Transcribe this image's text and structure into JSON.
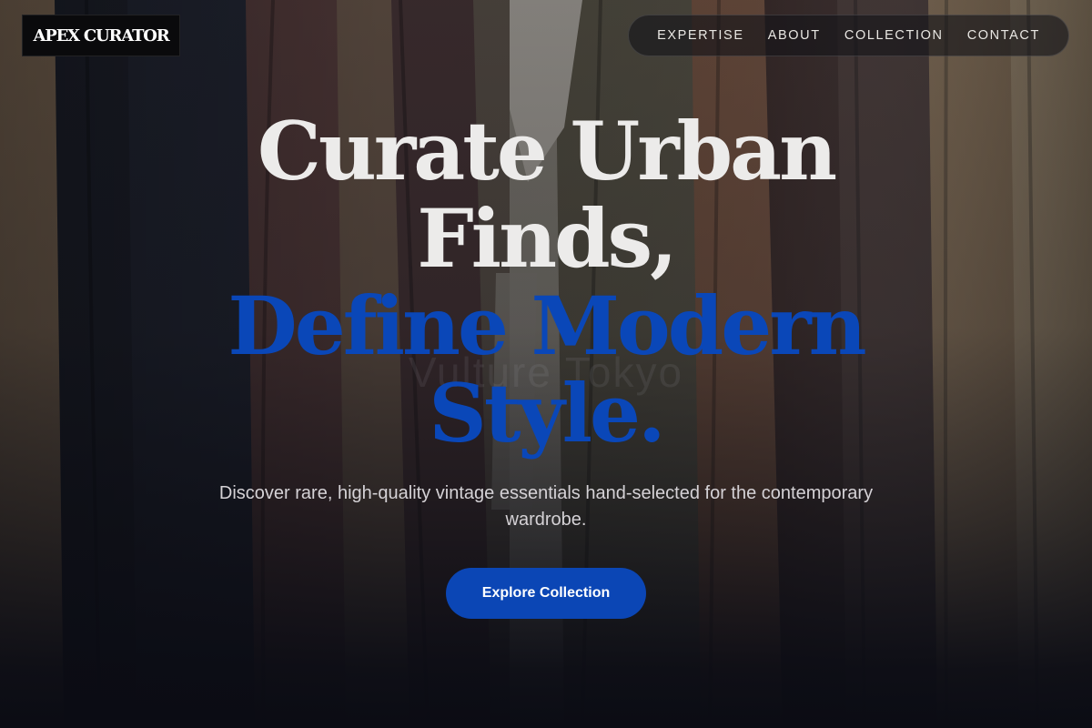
{
  "brand": {
    "logo_text": "APEX CURATOR"
  },
  "nav": {
    "items": [
      {
        "label": "EXPERTISE"
      },
      {
        "label": "ABOUT"
      },
      {
        "label": "COLLECTION"
      },
      {
        "label": "CONTACT"
      }
    ]
  },
  "hero": {
    "headline_line1": "Curate Urban",
    "headline_line2": "Finds,",
    "headline_line3": "Define Modern",
    "headline_line4": "Style.",
    "watermark": "Vulture Tokyo",
    "subtitle": "Discover rare, high-quality vintage essentials hand-selected for the contemporary wardrobe.",
    "cta_label": "Explore Collection"
  },
  "colors": {
    "accent_blue": "#0b46b5",
    "headline_light": "#ecebea",
    "background_dark": "#0b0c14"
  }
}
